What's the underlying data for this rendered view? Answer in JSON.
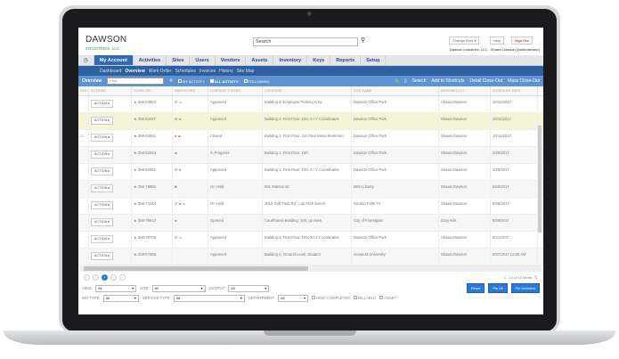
{
  "header": {
    "logo_line1": "DAWSON",
    "logo_line2": "INDUSTRIES, LLC",
    "search_placeholder": "Search",
    "change_role": "Change Role ▾",
    "help": "Help",
    "sign_out": "Sign Out",
    "user": "Dawson Industries, LLC - Shawn Dawson (Administrator)"
  },
  "tabs": [
    "My Account",
    "Activities",
    "Sites",
    "Users",
    "Vendors",
    "Assets",
    "Inventory",
    "Keys",
    "Reports",
    "Setup"
  ],
  "subnav": [
    "Dashboard",
    "Overview",
    "Work Order",
    "Schedules",
    "Invoices",
    "History",
    "Site Map"
  ],
  "toolbar": {
    "title": "Overview",
    "find_placeholder": "Find...",
    "my_activity": "MY ACTIVITY",
    "all_activity": "ALL ACTIVITY",
    "following": "FOLLOWING",
    "search": "Search",
    "add_shortcuts": "Add to Shortcuts",
    "detail_close": "Detail Close-Out",
    "mass_close": "Mass Close-Out"
  },
  "columns": [
    "FILE",
    "ACTIONS",
    "WORK OR...",
    "INDICATORS",
    "CURRENT STATUS",
    "LOCATION",
    "SITE NAME",
    "ASSIGNED TO",
    "SCHEDULE DATE"
  ],
  "action_label": "ACTION ▸",
  "rows": [
    {
      "wo": "356-63553",
      "ind": "⚙ ▭",
      "status": "Approved",
      "loc": "Building 2: Employee Parking Area",
      "site": "Dawson Office Park",
      "assigned": "Shawn Dawson",
      "date": "10/13/2017"
    },
    {
      "wo": "356-63427",
      "ind": "⚙ ●",
      "status": "Approved",
      "loc": "Building 1: First Floor, 100, X / Y Coordinates",
      "site": "Dawson Office Park",
      "assigned": "Shawn Dawson",
      "date": "10/13/2017"
    },
    {
      "wo": "356-63051",
      "ind": "● ▰",
      "status": "Closed",
      "loc": "Building 1: First Floor, 1st Floor Mens Restroom,",
      "site": "Dawson Office Park",
      "assigned": "Shawn Dawson",
      "date": "10/13/2017"
    },
    {
      "wo": "356-62924",
      "ind": "▰",
      "status": "In Progress",
      "loc": "Building 1: First Floor, 100,",
      "site": "Dawson Office Park",
      "assigned": "Shawn Dawson",
      "date": "10/5/2017"
    },
    {
      "wo": "356-62681",
      "ind": "⚙ ●",
      "status": "Approved",
      "loc": "Building 1: First Floor, 100, X / Y Coordinates",
      "site": "Dawson Office Park",
      "assigned": "Shawn Dawson",
      "date": "10/5/2017"
    },
    {
      "wo": "356-78855",
      "ind": "■",
      "status": "On Hold",
      "loc": "801 Watson Dr.",
      "site": "DDH Liberty",
      "assigned": "Shawn Dawson",
      "date": "9/28/2017"
    },
    {
      "wo": "356-73444",
      "ind": "⚙ ● ▭",
      "status": "On Hold",
      "loc": "3015 Golf Field Rd : Lab Tech bench",
      "site": "Wichita Falls TX",
      "assigned": "Shawn Dawson",
      "date": "9/28/2017"
    },
    {
      "wo": "356-78513",
      "ind": "●",
      "status": "Opened",
      "loc": "Courthouse Building: 100, go Here",
      "site": "City of Forestgate",
      "assigned": "Gary Kirk",
      "date": "9/26/2017"
    },
    {
      "wo": "356-75705",
      "ind": "⚙ ▭",
      "status": "Approved",
      "loc": "Building 1: First Floor, 100, X / Y Coordinates",
      "site": "Dawson Office Park",
      "assigned": "Shawn Dawson",
      "date": "9/21/2017"
    },
    {
      "wo": "356-67066",
      "ind": "",
      "status": "Approved",
      "loc": "Building A: Ground Level, Student",
      "site": "Greatest University",
      "assigned": "Shawn Dawson",
      "date": "9/07/2017 12:55 AM"
    }
  ],
  "pager": {
    "page": "1",
    "count": "1 - 12 of 12 items"
  },
  "filters": {
    "view_label": "VIEW",
    "view": "All",
    "site_label": "SITE",
    "site": "All",
    "output_label": "OUTPUT",
    "output": "All",
    "wo_type_label": "WO TYPE",
    "wo_type": "All",
    "service_type_label": "SERVICE TYPE",
    "service_type": "All",
    "department_label": "DEPARTMENT",
    "department": "All",
    "hide_completed": "HIDE COMPLETED",
    "billable": "BILLABLE",
    "asset": "ASSET",
    "reset": "Reset",
    "pin_all": "Pin All",
    "pin_selected": "Pin Selected"
  }
}
